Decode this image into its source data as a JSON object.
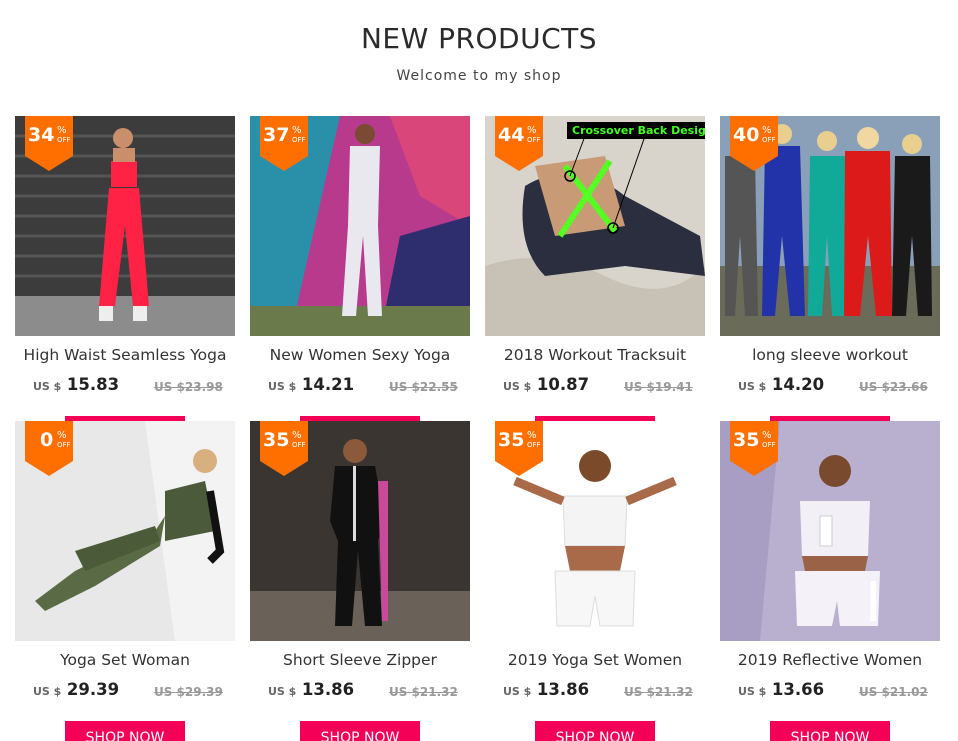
{
  "header": {
    "title": "NEW PRODUCTS",
    "subtitle": "Welcome to my shop"
  },
  "currency_label": "US $",
  "shop_now_label": "SHOP NOW",
  "badge": {
    "percent_sign": "%",
    "off": "OFF"
  },
  "colors": {
    "accent": "#f50057",
    "badge": "#ff6f00"
  },
  "products": [
    {
      "discount": "34",
      "name": "High Waist Seamless Yoga",
      "price": "15.83",
      "old_price": "US $23.98"
    },
    {
      "discount": "37",
      "name": "New Women Sexy Yoga",
      "price": "14.21",
      "old_price": "US $22.55"
    },
    {
      "discount": "44",
      "name": "2018 Workout Tracksuit",
      "price": "10.87",
      "old_price": "US $19.41",
      "callout": "Crossover Back Design"
    },
    {
      "discount": "40",
      "name": "long sleeve workout",
      "price": "14.20",
      "old_price": "US $23.66"
    },
    {
      "discount": "0",
      "name": "Yoga Set Woman",
      "price": "29.39",
      "old_price": "US $29.39"
    },
    {
      "discount": "35",
      "name": "Short Sleeve Zipper",
      "price": "13.86",
      "old_price": "US $21.32"
    },
    {
      "discount": "35",
      "name": "2019 Yoga Set Women",
      "price": "13.86",
      "old_price": "US $21.32"
    },
    {
      "discount": "35",
      "name": "2019 Reflective Women",
      "price": "13.66",
      "old_price": "US $21.02"
    }
  ]
}
